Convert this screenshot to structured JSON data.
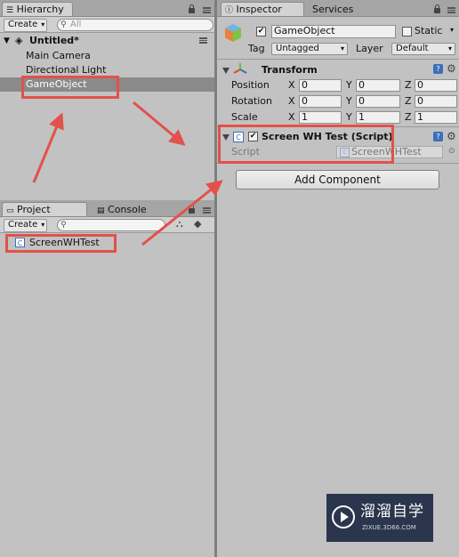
{
  "hierarchy": {
    "tab_label": "Hierarchy",
    "create_label": "Create",
    "search_placeholder": "All",
    "scene_name": "Untitled*",
    "items": [
      "Main Camera",
      "Directional Light",
      "GameObject"
    ]
  },
  "project": {
    "tab_project": "Project",
    "tab_console": "Console",
    "create_label": "Create",
    "asset_name": "ScreenWHTest"
  },
  "inspector": {
    "tab_inspector": "Inspector",
    "tab_services": "Services",
    "object_name": "GameObject",
    "static_label": "Static",
    "tag_label": "Tag",
    "tag_value": "Untagged",
    "layer_label": "Layer",
    "layer_value": "Default",
    "transform": {
      "title": "Transform",
      "rows": [
        {
          "label": "Position",
          "x": "0",
          "y": "0",
          "z": "0"
        },
        {
          "label": "Rotation",
          "x": "0",
          "y": "0",
          "z": "0"
        },
        {
          "label": "Scale",
          "x": "1",
          "y": "1",
          "z": "1"
        }
      ],
      "axis_x": "X",
      "axis_y": "Y",
      "axis_z": "Z"
    },
    "script_component": {
      "title": "Screen WH Test (Script)",
      "field_label": "Script",
      "field_value": "ScreenWHTest"
    },
    "add_component_label": "Add Component"
  },
  "watermark": {
    "brand_cn": "溜溜自学",
    "brand_url": "ZIXUE.3D66.COM"
  },
  "colors": {
    "highlight": "#e2514a",
    "selection": "#8a8a8a",
    "watermark_bg": "#1f2a44"
  }
}
